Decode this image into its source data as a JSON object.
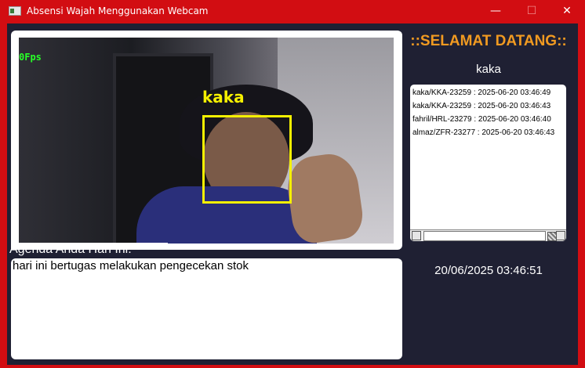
{
  "window": {
    "title": "Absensi Wajah Menggunakan Webcam",
    "controls": {
      "minimize": "—",
      "maximize": "☐",
      "close": "✕"
    }
  },
  "video": {
    "fps_text": "0Fps",
    "face_label": "kaka"
  },
  "agenda": {
    "label": "Agenda Anda Hari Ini:",
    "text": "hari ini bertugas melakukan pengecekan stok"
  },
  "sidebar": {
    "welcome": "::SELAMAT DATANG::",
    "user_name": "kaka",
    "log": [
      "kaka/KKA-23259 : 2025-06-20 03:46:49",
      "kaka/KKA-23259 : 2025-06-20 03:46:43",
      "fahril/HRL-23279 : 2025-06-20 03:46:40",
      "almaz/ZFR-23277 : 2025-06-20 03:46:43"
    ],
    "datetime": "20/06/2025 03:46:51"
  },
  "colors": {
    "titlebar": "#d20d12",
    "background": "#1f2033",
    "welcome_text": "#f19a21",
    "face_box": "#f5f000",
    "fps_text": "#28ff28"
  }
}
